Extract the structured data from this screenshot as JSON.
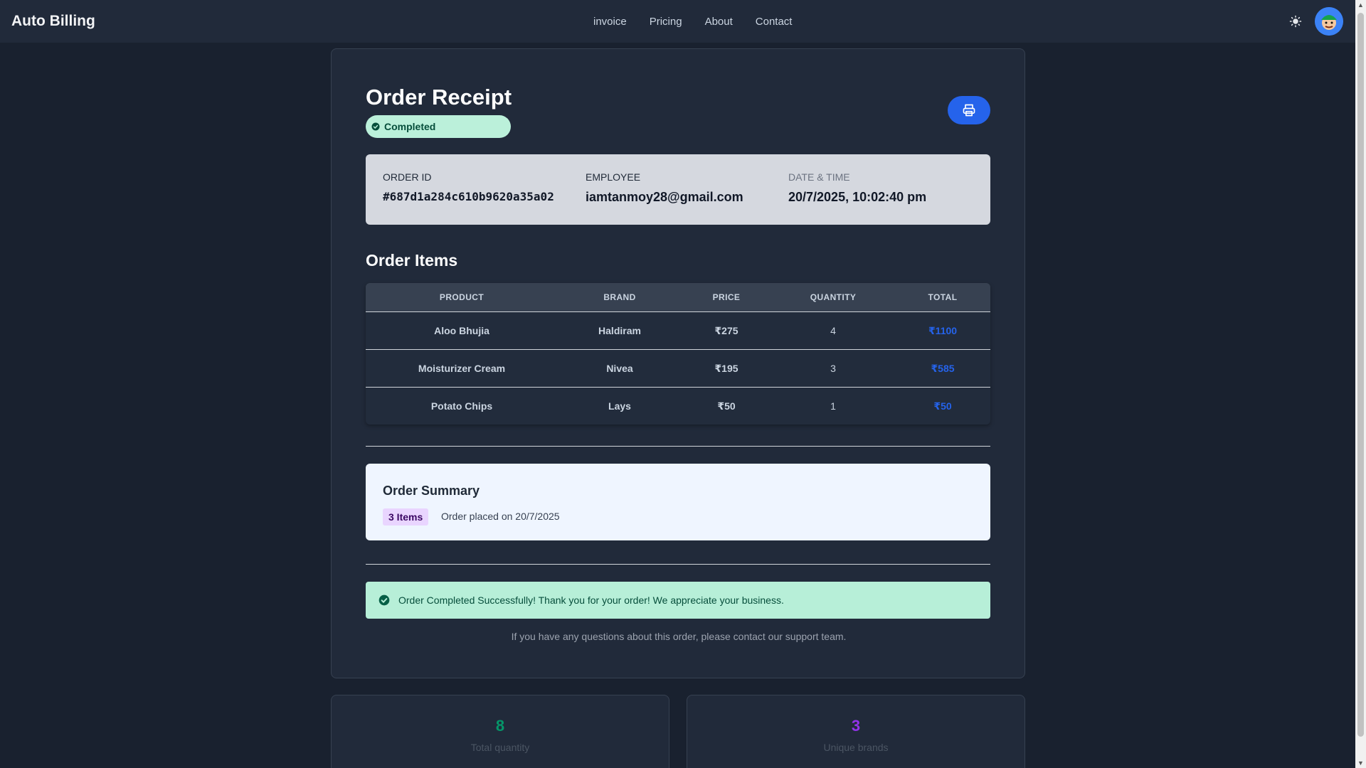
{
  "navbar": {
    "brand": "Auto Billing",
    "links": [
      "invoice",
      "Pricing",
      "About",
      "Contact"
    ]
  },
  "receipt": {
    "title": "Order Receipt",
    "status": "Completed",
    "order_id_label": "ORDER ID",
    "order_id": "#687d1a284c610b9620a35a02",
    "employee_label": "EMPLOYEE",
    "employee": "iamtanmoy28@gmail.com",
    "datetime_label": "DATE & TIME",
    "datetime": "20/7/2025, 10:02:40 pm",
    "items_title": "Order Items"
  },
  "table": {
    "headers": [
      "PRODUCT",
      "BRAND",
      "PRICE",
      "QUANTITY",
      "TOTAL"
    ],
    "rows": [
      {
        "product": "Aloo Bhujia",
        "brand": "Haldiram",
        "price": "₹275",
        "quantity": "4",
        "total": "₹1100"
      },
      {
        "product": "Moisturizer Cream",
        "brand": "Nivea",
        "price": "₹195",
        "quantity": "3",
        "total": "₹585"
      },
      {
        "product": "Potato Chips",
        "brand": "Lays",
        "price": "₹50",
        "quantity": "1",
        "total": "₹50"
      }
    ]
  },
  "summary": {
    "title": "Order Summary",
    "items_badge": "3 Items",
    "placed_text": "Order placed on 20/7/2025"
  },
  "success_message": "Order Completed Successfully! Thank you for your order! We appreciate your business.",
  "help_text": "If you have any questions about this order, please contact our support team.",
  "stats": [
    {
      "value": "8",
      "label": "Total quantity",
      "color": "#059669"
    },
    {
      "value": "3",
      "label": "Unique brands",
      "color": "#9333ea"
    }
  ],
  "colors": {
    "accent": "#2563eb",
    "success_bg": "#b7efd8",
    "background": "#19212f"
  },
  "icons": {
    "theme": "sun-icon",
    "print": "printer-icon",
    "status": "check-circle-icon"
  }
}
